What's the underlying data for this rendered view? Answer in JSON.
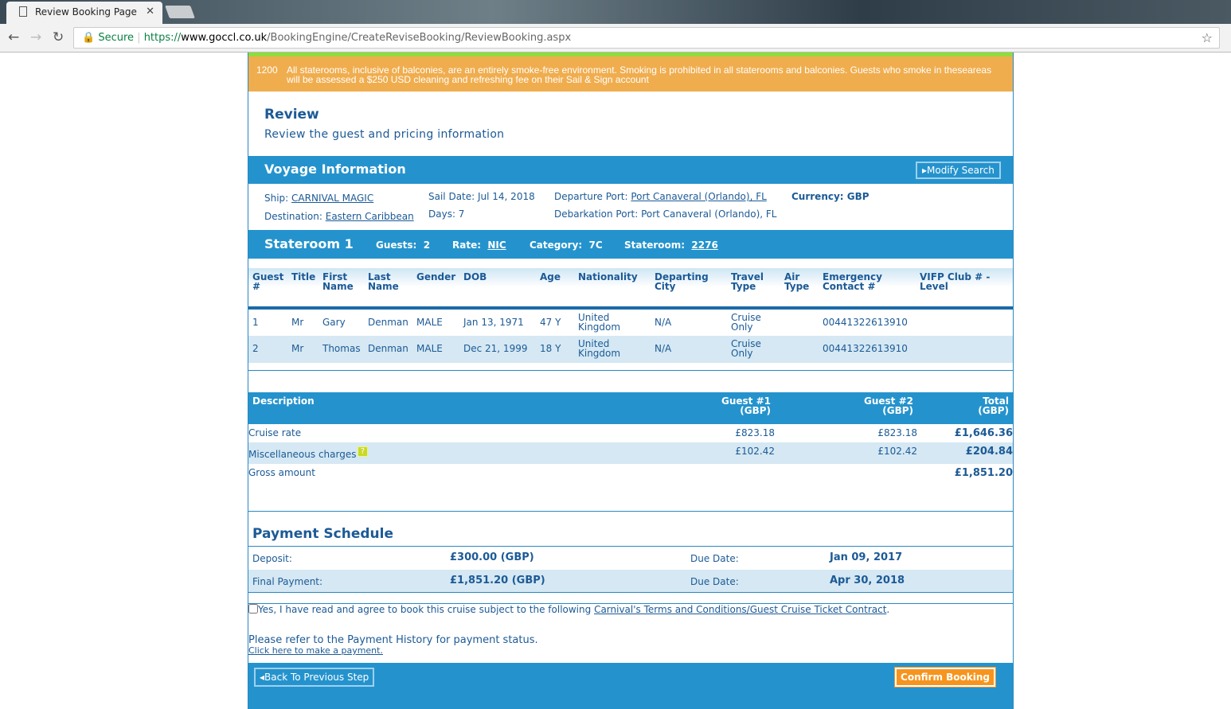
{
  "browser": {
    "tab_title": "Review Booking Page",
    "secure_label": "Secure",
    "url_prefix": "https://",
    "url_host": "www.goccl.co.uk",
    "url_path": "/BookingEngine/CreateReviseBooking/ReviewBooking.aspx"
  },
  "notice": {
    "code": "1200",
    "line1": "All staterooms, inclusive of balconies, are an entirely smoke-free environment. Smoking is prohibited in all staterooms and balconies. Guests who smoke in theseareas",
    "line2": "will be assessed a $250 USD cleaning and refreshing fee on their Sail & Sign account"
  },
  "review": {
    "title": "Review",
    "subtitle": "Review the guest and pricing information"
  },
  "voyage": {
    "title": "Voyage Information",
    "modify_label": "Modify Search",
    "ship_label": "Ship:",
    "ship": "CARNIVAL MAGIC",
    "destination_label": "Destination:",
    "destination": "Eastern Caribbean",
    "sail_date": "Sail Date: Jul 14, 2018",
    "days": "Days: 7",
    "departure_label": "Departure Port:",
    "departure": "Port Canaveral (Orlando), FL",
    "debarkation": "Debarkation Port: Port Canaveral (Orlando), FL",
    "currency": "Currency: GBP"
  },
  "stateroom": {
    "title": "Stateroom 1",
    "guests_label": "Guests:",
    "guests": "2",
    "rate_label": "Rate:",
    "rate": "NIC",
    "category_label": "Category:",
    "category": "7C",
    "stateroom_label": "Stateroom:",
    "stateroom": "2276"
  },
  "guest_table": {
    "headers": [
      [
        "Guest",
        "#"
      ],
      [
        "Title",
        ""
      ],
      [
        "First",
        "Name"
      ],
      [
        "Last",
        "Name"
      ],
      [
        "Gender",
        ""
      ],
      [
        "DOB",
        ""
      ],
      [
        "Age",
        ""
      ],
      [
        "Nationality",
        ""
      ],
      [
        "Departing",
        "City"
      ],
      [
        "Travel",
        "Type"
      ],
      [
        "Air",
        "Type"
      ],
      [
        "Emergency",
        "Contact #"
      ],
      [
        "VIFP Club # -",
        "Level"
      ]
    ],
    "rows": [
      [
        "1",
        "Mr",
        "Gary",
        "Denman",
        "MALE",
        "Jan 13, 1971",
        "47 Y",
        "United",
        "Kingdom",
        "N/A",
        "Cruise",
        "Only",
        "",
        "00441322613910",
        ""
      ],
      [
        "2",
        "Mr",
        "Thomas",
        "Denman",
        "MALE",
        "Dec 21, 1999",
        "18 Y",
        "United",
        "Kingdom",
        "N/A",
        "Cruise",
        "Only",
        "",
        "00441322613910",
        ""
      ]
    ]
  },
  "pricing": {
    "headers": [
      "Description",
      "Guest #1",
      "(GBP)",
      "Guest #2",
      "(GBP)",
      "Total",
      "(GBP)"
    ],
    "rows": [
      [
        "Cruise rate",
        "£823.18",
        "£823.18",
        "£1,646.36"
      ],
      [
        "Miscellaneous charges",
        "£102.42",
        "£102.42",
        "£204.84"
      ],
      [
        "Gross amount",
        "",
        "",
        "£1,851.20"
      ]
    ]
  },
  "payment": {
    "title": "Payment Schedule",
    "rows": [
      [
        "Deposit:",
        "£300.00 (GBP)",
        "Due Date:",
        "Jan 09, 2017"
      ],
      [
        "Final Payment:",
        "£1,851.20 (GBP)",
        "Due Date:",
        "Apr 30, 2018"
      ]
    ]
  },
  "agree": {
    "text": "Yes, I have read and agree to book this cruise subject to the following ",
    "link": "Carnival's Terms and Conditions/Guest Cruise Ticket Contract",
    "end": "."
  },
  "history": {
    "text": "Please refer to the Payment History for payment status.",
    "link": "Click here to make a payment."
  },
  "footer": {
    "back_label": "Back To Previous Step",
    "confirm_label": "Confirm Booking"
  }
}
